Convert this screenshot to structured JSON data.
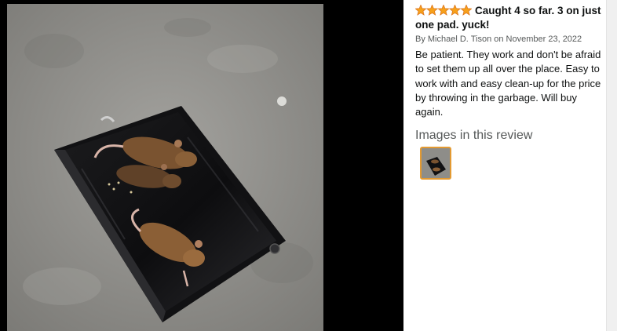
{
  "review": {
    "rating": 5,
    "rating_max": 5,
    "title": "Caught 4 so far. 3 on just one pad. yuck!",
    "byline": "By Michael D. Tison on November 23, 2022",
    "body": "Be patient. They work and don't be afraid to set them up all over the place. Easy to work with and easy clean-up for the price by throwing in the garbage. Will buy again."
  },
  "images_section": {
    "heading": "Images in this review"
  },
  "colors": {
    "star": "#f7a11a",
    "thumb_border": "#e39a32",
    "lightbox_bg": "#000000"
  },
  "icons": [
    "star-icon"
  ]
}
